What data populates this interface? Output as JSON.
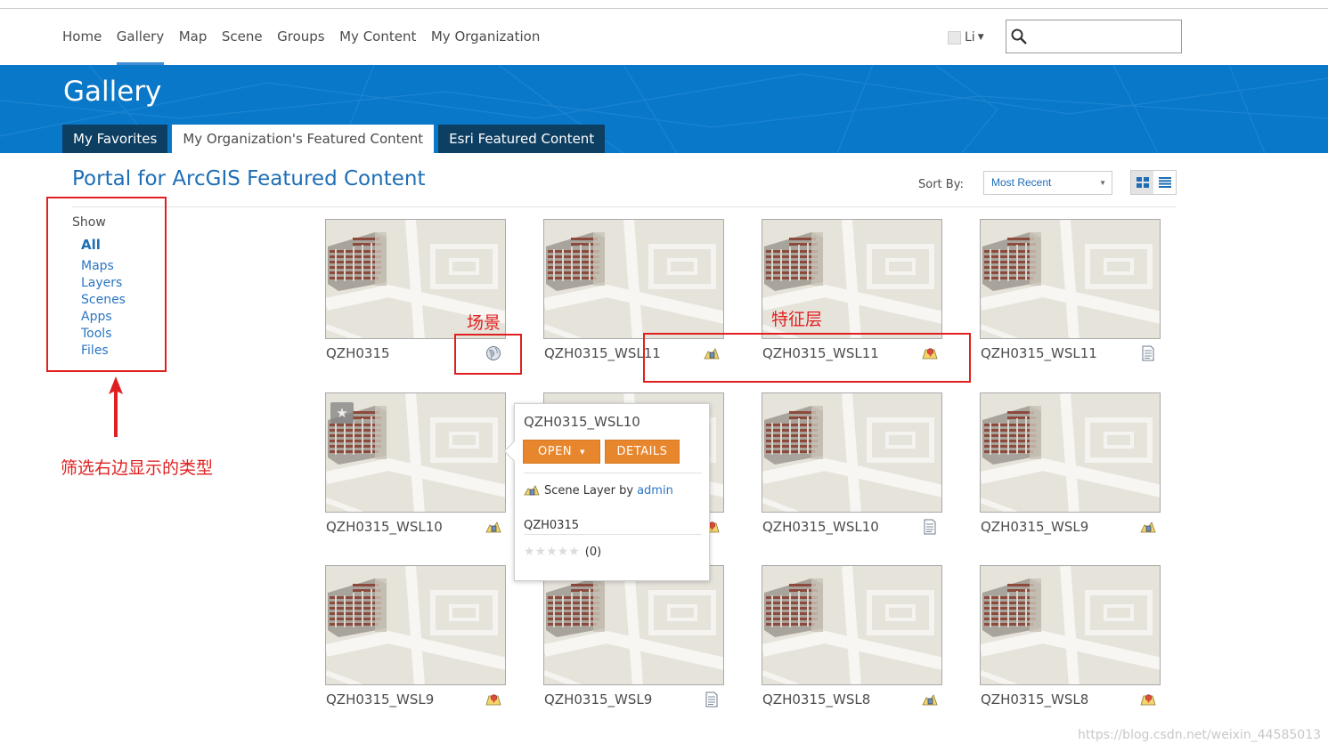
{
  "nav": {
    "links": [
      "Home",
      "Gallery",
      "Map",
      "Scene",
      "Groups",
      "My Content",
      "My Organization"
    ],
    "active": "Gallery",
    "user": "Li",
    "search_placeholder": ""
  },
  "banner": {
    "title": "Gallery",
    "tabs": [
      "My Favorites",
      "My Organization's Featured Content",
      "Esri Featured Content"
    ],
    "selected_tab": "My Organization's Featured Content"
  },
  "content": {
    "title": "Portal for ArcGIS Featured Content",
    "sort_label": "Sort By:",
    "sort_value": "Most Recent"
  },
  "filter": {
    "show_label": "Show",
    "items": [
      "All",
      "Maps",
      "Layers",
      "Scenes",
      "Apps",
      "Tools",
      "Files"
    ]
  },
  "cards": [
    {
      "title": "QZH0315",
      "type": "globe-icon"
    },
    {
      "title": "QZH0315_WSL11",
      "type": "scene-layer-icon"
    },
    {
      "title": "QZH0315_WSL11",
      "type": "feature-layer-icon"
    },
    {
      "title": "QZH0315_WSL11",
      "type": "document-icon"
    },
    {
      "title": "QZH0315_WSL10",
      "type": "scene-layer-icon"
    },
    {
      "title": "",
      "type": "feature-layer-icon"
    },
    {
      "title": "QZH0315_WSL10",
      "type": "document-icon"
    },
    {
      "title": "QZH0315_WSL9",
      "type": "scene-layer-icon"
    },
    {
      "title": "QZH0315_WSL9",
      "type": "feature-layer-icon"
    },
    {
      "title": "QZH0315_WSL9",
      "type": "document-icon"
    },
    {
      "title": "QZH0315_WSL8",
      "type": "scene-layer-icon"
    },
    {
      "title": "QZH0315_WSL8",
      "type": "feature-layer-icon"
    }
  ],
  "popup": {
    "title": "QZH0315_WSL10",
    "open_label": "OPEN",
    "details_label": "DETAILS",
    "type_label": "Scene Layer by",
    "owner": "admin",
    "group": "QZH0315",
    "rating_count": "(0)"
  },
  "annotations": {
    "scene": "场景",
    "feature_layer": "特征层",
    "filter_note": "筛选右边显示的类型"
  },
  "watermark": "https://blog.csdn.net/weixin_44585013",
  "colors": {
    "banner": "#0a78c8",
    "tab_dark": "#0d3f63",
    "link": "#2a76c4",
    "button": "#e8862d",
    "annotation": "#e02020"
  }
}
